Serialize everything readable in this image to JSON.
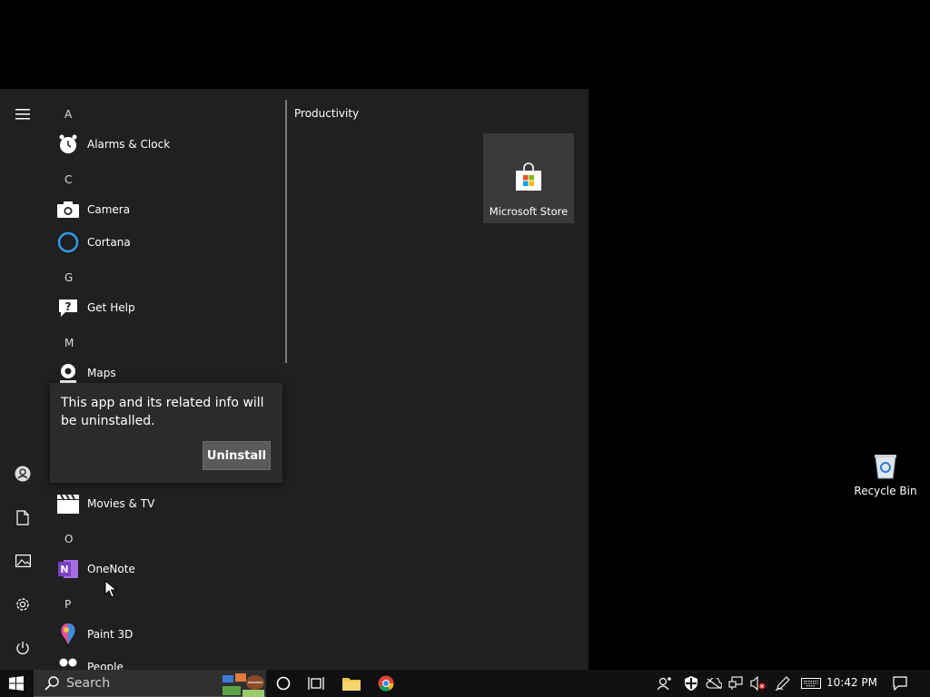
{
  "start_menu": {
    "letters": {
      "a": "A",
      "c": "C",
      "g": "G",
      "m": "M",
      "o": "O",
      "p": "P"
    },
    "apps": {
      "alarms": "Alarms & Clock",
      "camera": "Camera",
      "cortana": "Cortana",
      "get_help": "Get Help",
      "maps": "Maps",
      "movies": "Movies & TV",
      "onenote": "OneNote",
      "paint3d": "Paint 3D",
      "people": "People"
    },
    "group_title": "Productivity",
    "tile_label": "Microsoft Store"
  },
  "flyout": {
    "message": "This app and its related info will be uninstalled.",
    "button": "Uninstall"
  },
  "desktop": {
    "recycle_bin": "Recycle Bin"
  },
  "taskbar": {
    "search_placeholder": "Search",
    "clock": "10:42 PM"
  },
  "colors": {
    "start_bg": "#202020",
    "taskbar_bg": "#101010",
    "cortana_blue": "#2da0f0",
    "onenote_purple": "#7a3fc3"
  }
}
